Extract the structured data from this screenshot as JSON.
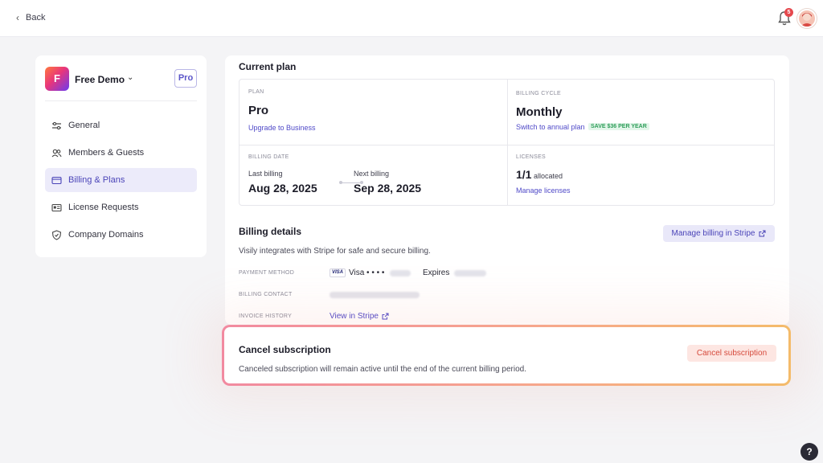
{
  "topbar": {
    "back_label": "Back",
    "notification_count": "5"
  },
  "sidebar": {
    "workspace_initial": "F",
    "workspace_name": "Free Demo",
    "plan_badge": "Pro",
    "items": [
      {
        "label": "General",
        "icon": "sliders-icon"
      },
      {
        "label": "Members & Guests",
        "icon": "users-icon"
      },
      {
        "label": "Billing & Plans",
        "icon": "credit-card-icon",
        "active": true
      },
      {
        "label": "License Requests",
        "icon": "id-card-icon"
      },
      {
        "label": "Company Domains",
        "icon": "shield-icon"
      }
    ]
  },
  "current_plan": {
    "title": "Current plan",
    "plan_caption": "PLAN",
    "plan_value": "Pro",
    "upgrade_link": "Upgrade to Business",
    "cycle_caption": "BILLING CYCLE",
    "cycle_value": "Monthly",
    "switch_link": "Switch to annual plan",
    "save_tag": "SAVE $36 PER YEAR",
    "billing_date_caption": "BILLING DATE",
    "last_billing_label": "Last billing",
    "last_billing_date": "Aug 28, 2025",
    "next_billing_label": "Next billing",
    "next_billing_date": "Sep 28, 2025",
    "licenses_caption": "LICENSES",
    "licenses_value": "1/1",
    "licenses_suffix": "allocated",
    "manage_licenses_link": "Manage licenses"
  },
  "billing_details": {
    "title": "Billing details",
    "manage_stripe_label": "Manage billing in Stripe",
    "description": "Visily integrates with Stripe for safe and secure billing.",
    "payment_method_label": "PAYMENT METHOD",
    "card_brand_logo": "VISA",
    "card_text": "Visa • • • •",
    "expires_label": "Expires",
    "billing_contact_label": "BILLING CONTACT",
    "invoice_history_label": "INVOICE HISTORY",
    "view_in_stripe_label": "View in Stripe"
  },
  "cancel": {
    "title": "Cancel subscription",
    "description": "Canceled subscription will remain active until the end of the current billing period.",
    "button_label": "Cancel subscription"
  },
  "help": {
    "label": "?"
  },
  "colors": {
    "accent": "#4f49c8",
    "danger": "#d64a3c",
    "success": "#2f9e5a"
  }
}
